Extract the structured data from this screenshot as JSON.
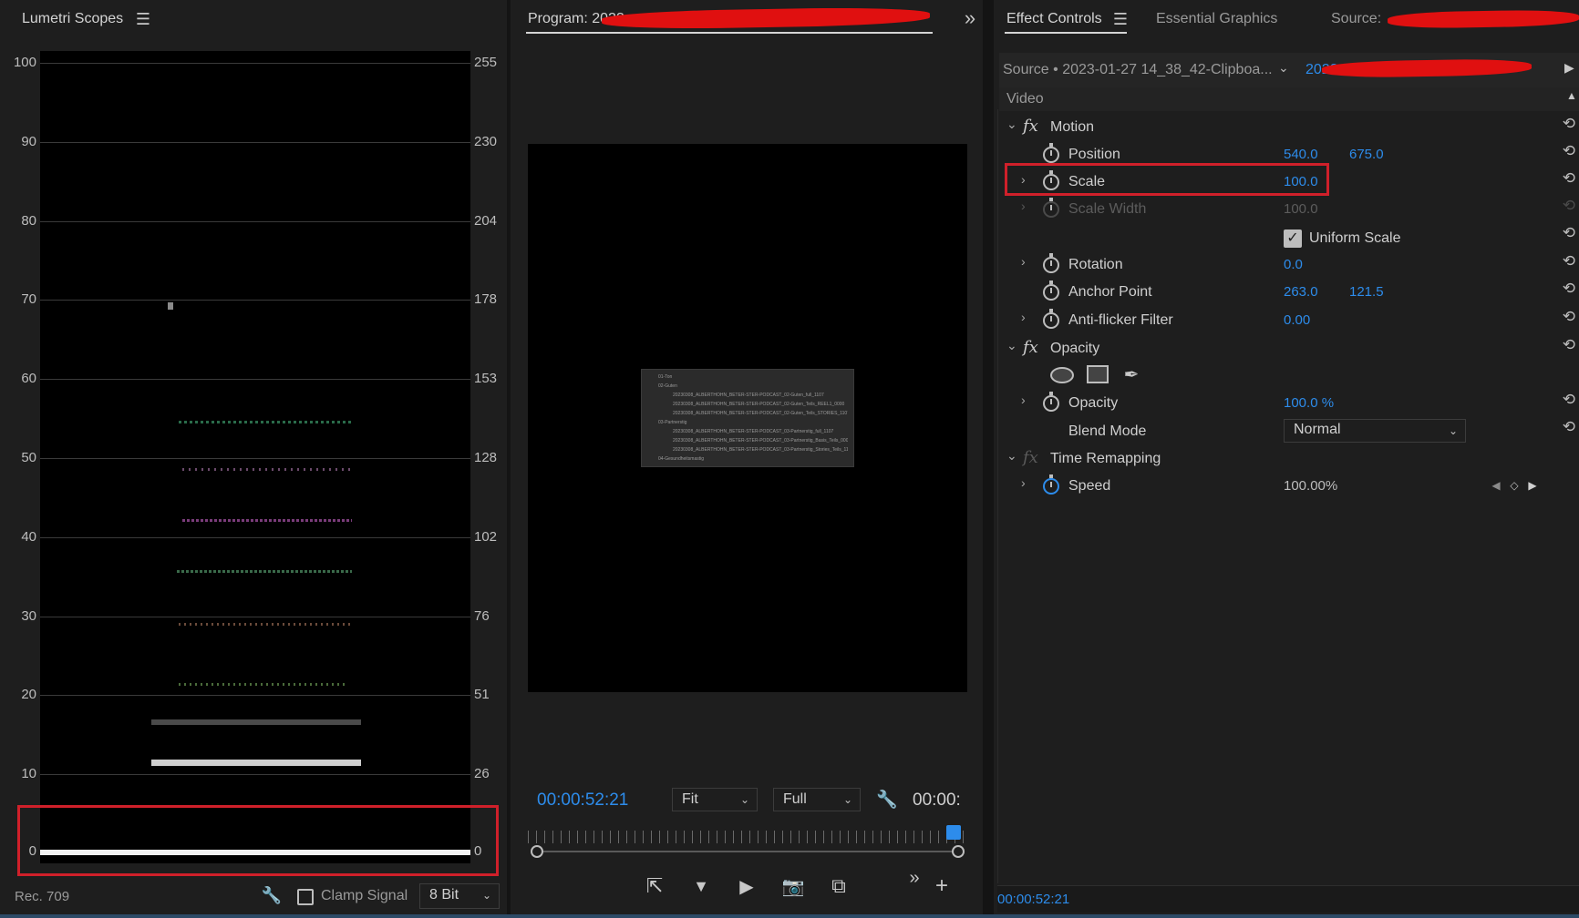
{
  "lumetri": {
    "title": "Lumetri Scopes",
    "scale_left": [
      "100",
      "90",
      "80",
      "70",
      "60",
      "50",
      "40",
      "30",
      "20",
      "10",
      "0"
    ],
    "scale_right": [
      "255",
      "230",
      "204",
      "178",
      "153",
      "128",
      "102",
      "76",
      "51",
      "26",
      "0"
    ],
    "footer_standard": "Rec. 709",
    "clamp_label": "Clamp Signal",
    "bit_depth": "8 Bit"
  },
  "program": {
    "title": "Program: 2023",
    "title_suffix": "...",
    "timecode": "00:00:52:21",
    "fit_option": "Fit",
    "quality_option": "Full",
    "timecode_right": "00:00:",
    "thumb_lines": [
      "01-Ton",
      "02-Guten",
      "20230308_ALBERTHOHN_BETER-STER-PODCAST_02-Guten_full_1107",
      "20230308_ALBERTHOHN_BETER-STER-PODCAST_02-Guten_Teils_REEL1_0000",
      "20230308_ALBERTHOHN_BETER-STER-PODCAST_02-Guten_Teils_STORIES_1107",
      "03-Partnerstig",
      "20230308_ALBERTHOHN_BETER-STER-PODCAST_03-Partnerstig_full_1107",
      "20230308_ALBERTHOHN_BETER-STER-PODCAST_03-Partnerstig_Basis_Teils_0000",
      "20230308_ALBERTHOHN_BETER-STER-PODCAST_03-Partnerstig_Stories_Teils_1107",
      "04-Gesundheitsmastig"
    ]
  },
  "effects": {
    "tabs": {
      "effect_controls": "Effect Controls",
      "essential_graphics": "Essential Graphics",
      "source": "Source: "
    },
    "source_clip": "Source • 2023-01-27 14_38_42-Clipboa...",
    "seq_clip": "2023",
    "section_video": "Video",
    "motion": {
      "name": "Motion",
      "position_label": "Position",
      "position_x": "540.0",
      "position_y": "675.0",
      "scale_label": "Scale",
      "scale_val": "100.0",
      "scale_width_label": "Scale Width",
      "scale_width_val": "100.0",
      "uniform_scale_label": "Uniform Scale",
      "rotation_label": "Rotation",
      "rotation_val": "0.0",
      "anchor_label": "Anchor Point",
      "anchor_x": "263.0",
      "anchor_y": "121.5",
      "antiflicker_label": "Anti-flicker Filter",
      "antiflicker_val": "0.00"
    },
    "opacity": {
      "name": "Opacity",
      "opacity_label": "Opacity",
      "opacity_val": "100.0",
      "opacity_unit": "%",
      "blend_label": "Blend Mode",
      "blend_val": "Normal"
    },
    "time_remap": {
      "name": "Time Remapping",
      "speed_label": "Speed",
      "speed_val": "100.00%"
    },
    "footer_timecode": "00:00:52:21"
  },
  "colors": {
    "accent": "#2d8ceb",
    "highlight": "#d0202a",
    "redaction": "#e01010"
  }
}
